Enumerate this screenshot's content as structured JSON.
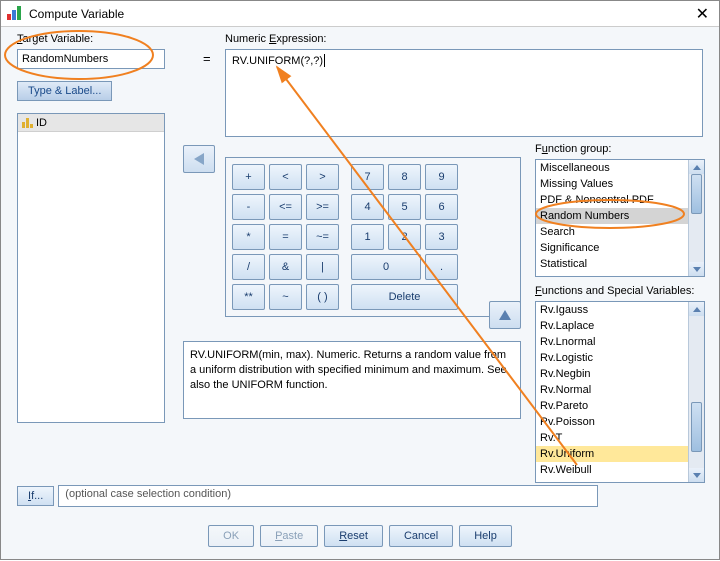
{
  "window": {
    "title": "Compute Variable"
  },
  "labels": {
    "target_variable": "Target Variable:",
    "numeric_expression": "Numeric Expression:",
    "type_and_label": "Type & Label...",
    "equals": "=",
    "function_group": "Function group:",
    "functions_and_special": "Functions and Special Variables:",
    "if_condition_placeholder": "(optional case selection condition)"
  },
  "target": {
    "value": "RandomNumbers"
  },
  "expression": {
    "value": "RV.UNIFORM(?,?)"
  },
  "variables": [
    {
      "name": "ID"
    }
  ],
  "keypad": {
    "rows": [
      [
        "+",
        "<",
        ">",
        "7",
        "8",
        "9"
      ],
      [
        "-",
        "<=",
        ">=",
        "4",
        "5",
        "6"
      ],
      [
        "*",
        "=",
        "~=",
        "1",
        "2",
        "3"
      ],
      [
        "/",
        "&",
        "|",
        "0",
        ".",
        ""
      ],
      [
        "**",
        "~",
        "( )",
        "Delete"
      ]
    ]
  },
  "help_text": "RV.UNIFORM(min, max). Numeric. Returns a random value from a uniform distribution with specified minimum and maximum. See also the UNIFORM function.",
  "function_groups": {
    "items": [
      "Miscellaneous",
      "Missing Values",
      "PDF & Noncentral PDF",
      "Random Numbers",
      "Search",
      "Significance",
      "Statistical"
    ],
    "selected": "Random Numbers"
  },
  "functions_list": {
    "items": [
      "Rv.Igauss",
      "Rv.Laplace",
      "Rv.Lnormal",
      "Rv.Logistic",
      "Rv.Negbin",
      "Rv.Normal",
      "Rv.Pareto",
      "Rv.Poisson",
      "Rv.T",
      "Rv.Uniform",
      "Rv.Weibull"
    ],
    "selected": "Rv.Uniform"
  },
  "buttons": {
    "if": "If...",
    "ok": "OK",
    "paste": "Paste",
    "reset": "Reset",
    "cancel": "Cancel",
    "help": "Help"
  }
}
